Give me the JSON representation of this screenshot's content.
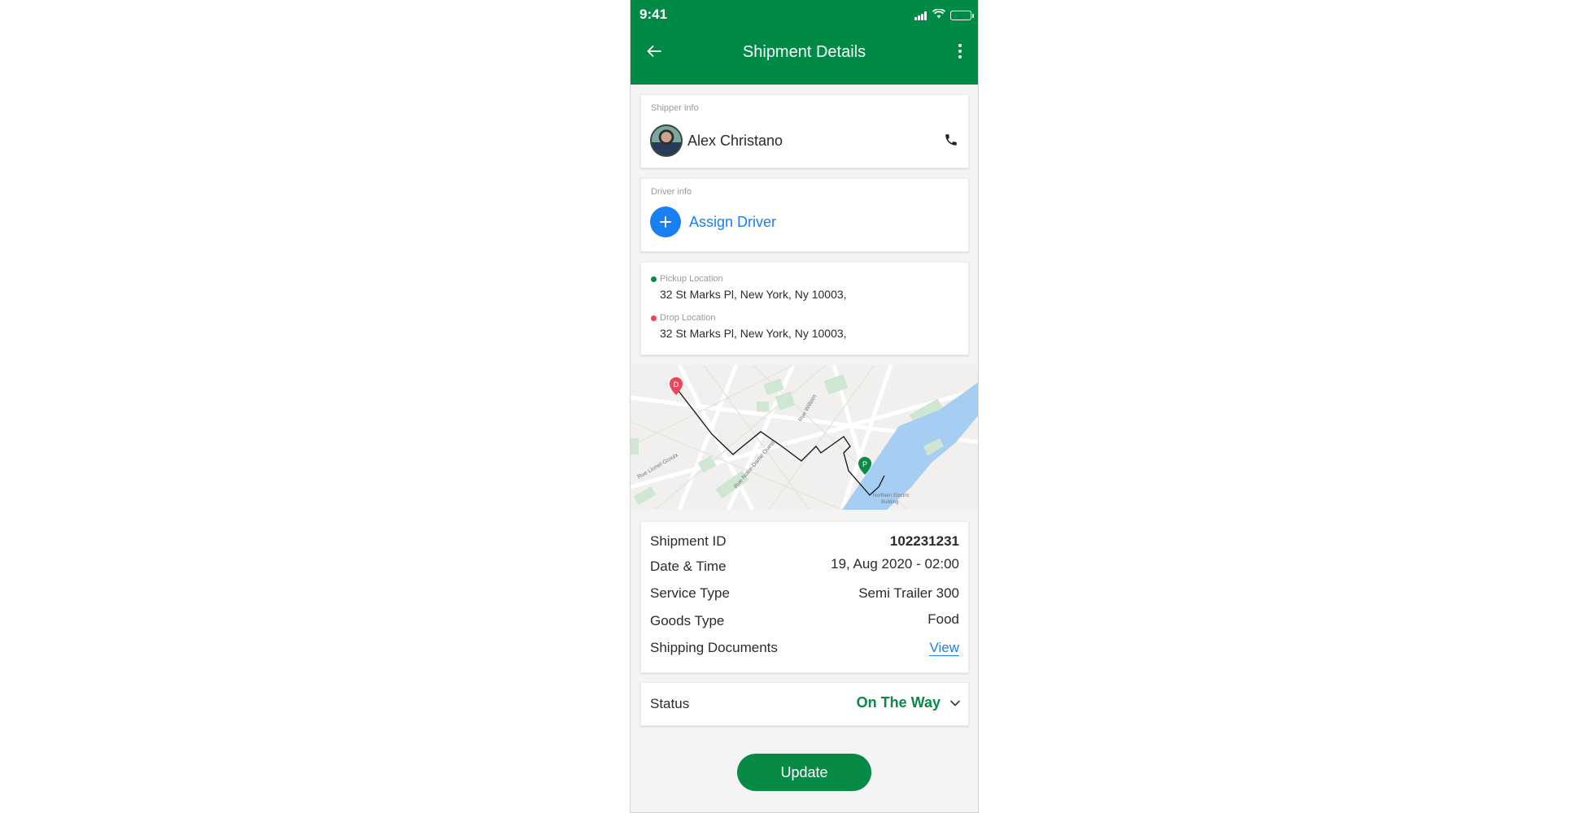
{
  "status_bar": {
    "time": "9:41"
  },
  "header": {
    "title": "Shipment Details"
  },
  "shipper": {
    "caption": "Shipper info",
    "name": "Alex Christano"
  },
  "driver": {
    "caption": "Driver info",
    "assign_label": "Assign Driver"
  },
  "locations": {
    "pickup": {
      "label": "Pickup Location",
      "address": "32 St Marks Pl, New York, Ny 10003,"
    },
    "drop": {
      "label": "Drop Location",
      "address": "32 St Marks Pl, New York, Ny 10003,"
    }
  },
  "map": {
    "labels": {
      "street1": "Rue Notre-Dame Ouest",
      "street2": "Rue William",
      "street3": "Rue Lionel-Groulx",
      "building": "Northern Electric",
      "building2": "Building",
      "pin_drop": "D",
      "pin_pickup": "P"
    }
  },
  "details": {
    "rows": [
      {
        "key": "Shipment ID",
        "value": "102231231"
      },
      {
        "key": "Date & Time",
        "value": "19, Aug 2020 - 02:00"
      },
      {
        "key": "Service Type",
        "value": "Semi Trailer 300"
      },
      {
        "key": "Goods Type",
        "value": "Food"
      },
      {
        "key": "Shipping Documents",
        "value": "View"
      }
    ]
  },
  "status": {
    "label": "Status",
    "value": "On The Way"
  },
  "actions": {
    "update_label": "Update"
  },
  "colors": {
    "brand_green": "#008a45",
    "link_blue": "#1a7ff0",
    "pickup_dot": "#0a8a45",
    "drop_dot": "#e8465a"
  },
  "icons": [
    "back-arrow-icon",
    "more-vertical-icon",
    "phone-icon",
    "plus-icon",
    "chevron-down-icon",
    "signal-icon",
    "wifi-icon",
    "battery-icon",
    "map-pin-icon"
  ]
}
